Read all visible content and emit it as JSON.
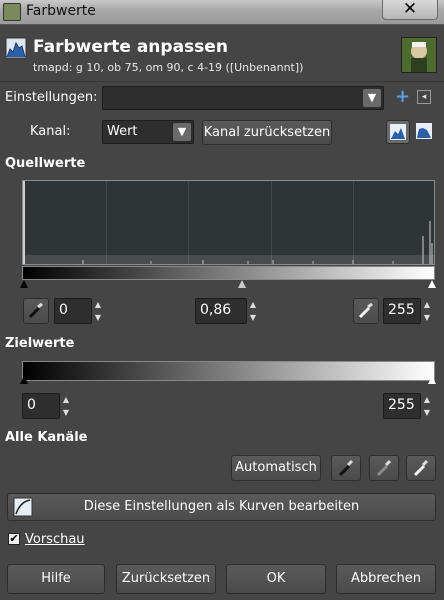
{
  "window": {
    "title": "Farbwerte",
    "close_glyph": "✕"
  },
  "header": {
    "title": "Farbwerte anpassen",
    "subtitle": "tmapd: g 10, ob 75, om 90, c 4-19 ([Unbenannt])"
  },
  "presets": {
    "label": "Einstellungen:",
    "value": "",
    "add_glyph": "+",
    "menu_glyph": "◂"
  },
  "channel": {
    "label": "Kanal:",
    "value": "Wert",
    "reset_label": "Kanal zurücksetzen",
    "scale_icons": [
      "linear-histogram-icon",
      "logarithmic-histogram-icon"
    ]
  },
  "source": {
    "title": "Quellwerte",
    "low": "0",
    "gamma": "0,86",
    "high": "255"
  },
  "target": {
    "title": "Zielwerte",
    "low": "0",
    "high": "255"
  },
  "all_channels": {
    "title": "Alle Kanäle",
    "auto_label": "Automatisch"
  },
  "curves_button": "Diese Einstellungen als Kurven bearbeiten",
  "preview": {
    "label": "Vorschau",
    "checked": true
  },
  "footer": {
    "help": "Hilfe",
    "reset": "Zurücksetzen",
    "ok": "OK",
    "cancel": "Abbrechen"
  }
}
